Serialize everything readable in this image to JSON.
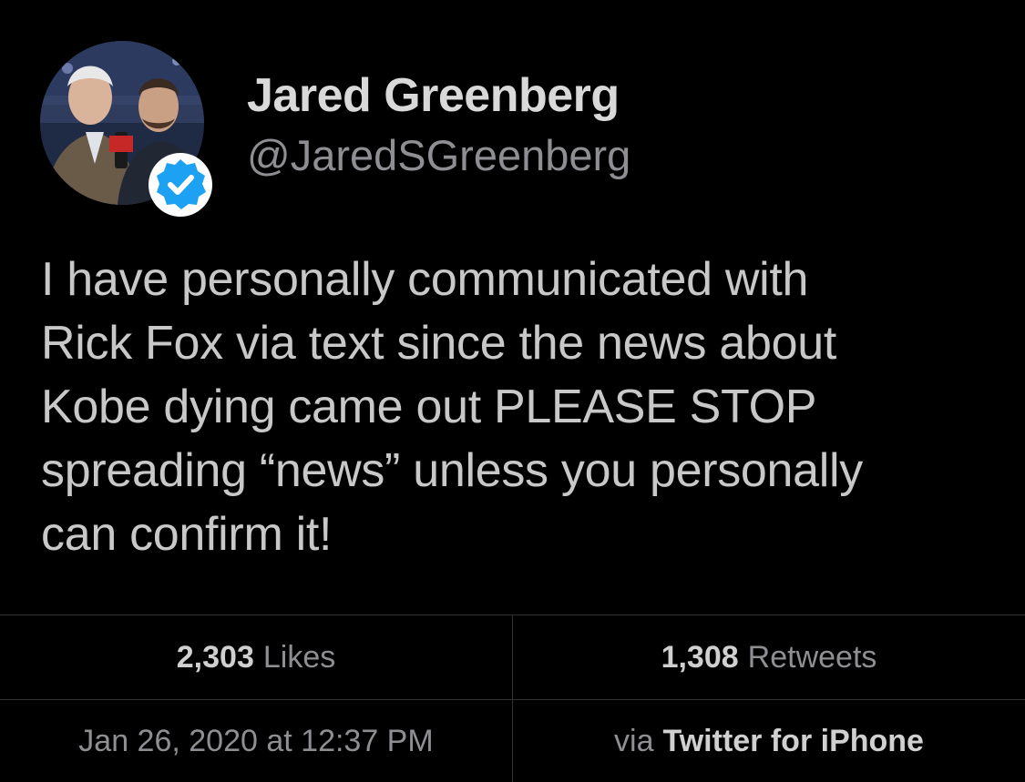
{
  "author": {
    "display_name": "Jared Greenberg",
    "handle": "@JaredSGreenberg",
    "verified": true,
    "avatar": "profile-photo",
    "verified_icon": "verified-badge-icon"
  },
  "tweet": {
    "text": "I have personally communicated with\nRick Fox via text since the news about\nKobe dying came out PLEASE STOP\nspreading “news” unless you personally\ncan confirm it!"
  },
  "stats": {
    "likes_count": "2,303",
    "likes_label": "Likes",
    "retweets_count": "1,308",
    "retweets_label": "Retweets"
  },
  "meta": {
    "timestamp": "Jan 26, 2020 at 12:37 PM",
    "via_label": "via",
    "source": "Twitter for iPhone"
  },
  "colors": {
    "background": "#000000",
    "verified": "#1da1f2",
    "divider": "#2f3336"
  }
}
